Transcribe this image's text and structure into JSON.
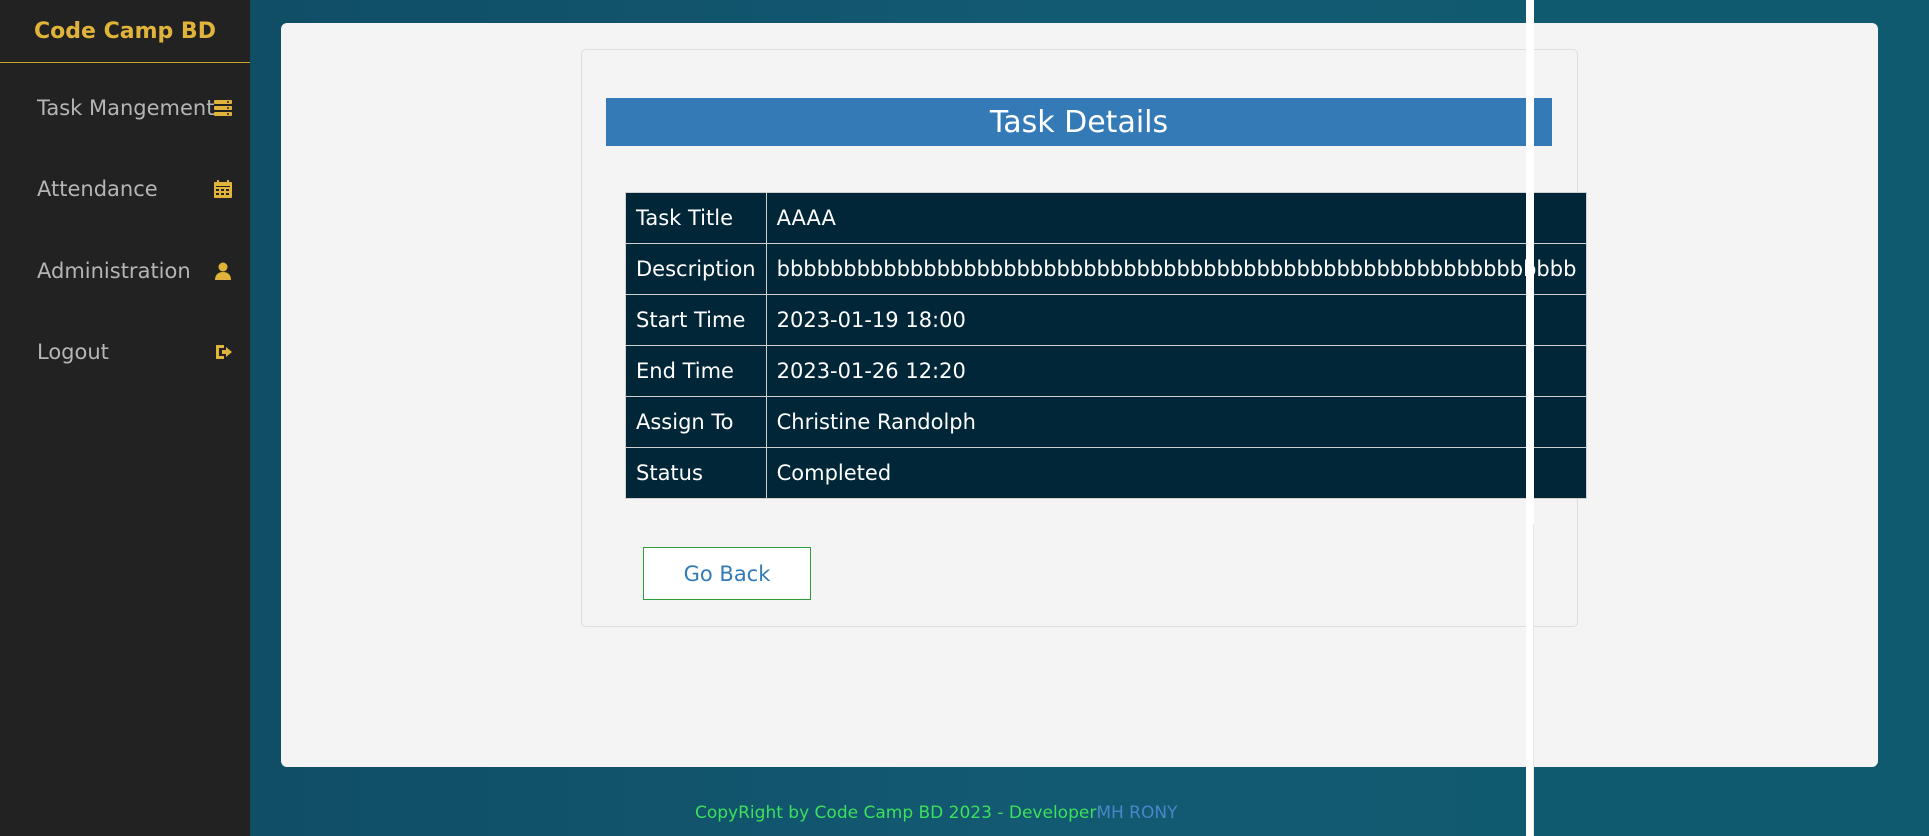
{
  "sidebar": {
    "brand": "Code Camp BD",
    "items": [
      {
        "label": "Task Mangement",
        "icon": "tasks-icon"
      },
      {
        "label": "Attendance",
        "icon": "calendar-icon"
      },
      {
        "label": "Administration",
        "icon": "user-icon"
      },
      {
        "label": "Logout",
        "icon": "logout-icon"
      }
    ]
  },
  "card": {
    "title": "Task Details",
    "rows": [
      {
        "key": "Task Title",
        "value": "AAAA"
      },
      {
        "key": "Description",
        "value": "bbbbbbbbbbbbbbbbbbbbbbbbbbbbbbbbbbbbbbbbbbbbbbbbbbbbbbbbbbbb"
      },
      {
        "key": "Start Time",
        "value": "2023-01-19 18:00"
      },
      {
        "key": "End Time",
        "value": "2023-01-26 12:20"
      },
      {
        "key": "Assign To",
        "value": "Christine Randolph"
      },
      {
        "key": "Status",
        "value": "Completed"
      }
    ],
    "back_label": "Go Back"
  },
  "footer": {
    "text": "CopyRight by Code Camp BD 2023 - Developer",
    "developer": "MH RONY"
  },
  "colors": {
    "accent": "#e0b43a",
    "header": "#337ab7",
    "table_bg": "#002638",
    "footer_text": "#3de05a"
  }
}
